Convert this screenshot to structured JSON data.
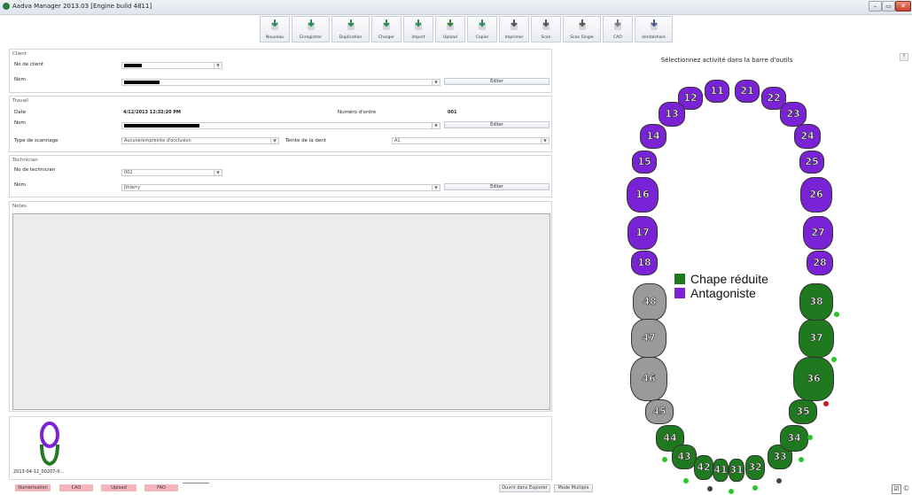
{
  "window": {
    "title": "Aadva Manager 2013.03 [Engine build 4811]",
    "controls": [
      "minimize",
      "restore",
      "close"
    ]
  },
  "toolbar": [
    {
      "label": "Nouveau",
      "icon": "new-tooth-icon"
    },
    {
      "label": "Enregistrer",
      "icon": "save-tooth-icon"
    },
    {
      "label": "Duplication",
      "icon": "duplicate-icon"
    },
    {
      "label": "Charger",
      "icon": "load-icon"
    },
    {
      "label": "Import",
      "icon": "import-icon"
    },
    {
      "label": "Upload",
      "icon": "upload-globe-icon"
    },
    {
      "label": "Copier",
      "icon": "copy-icon"
    },
    {
      "label": "Imprimer",
      "icon": "printer-icon"
    },
    {
      "label": "Scan",
      "icon": "scanner-icon"
    },
    {
      "label": "Scan Single",
      "icon": "scan-single-icon"
    },
    {
      "label": "CAO",
      "icon": "cad-icon"
    },
    {
      "label": "dentalshare",
      "icon": "dentalshare-icon"
    }
  ],
  "client": {
    "header": "Client",
    "no_label": "No de client",
    "name_label": "Nom",
    "edit": "Éditer"
  },
  "travail": {
    "header": "Travail",
    "date_label": "Date",
    "date_value": "4/12/2013  12:32:20 PM",
    "order_label": "Numéro d'ordre",
    "order_value": "001",
    "name_label": "Nom",
    "edit": "Éditer",
    "scan_type_label": "Type de scannage",
    "scan_type_value": "Aucune/empreinte d'occlusion",
    "shade_label": "Teinte de la dent",
    "shade_value": "A1"
  },
  "technician": {
    "header": "Technician",
    "no_label": "No de technicien",
    "no_value": "002",
    "name_label": "Nom",
    "name_value": "Jthierry",
    "edit": "Éditer"
  },
  "notes": {
    "header": "Notes"
  },
  "thumbnail": {
    "caption": "2013-04-12_00207-0..."
  },
  "status_chips": [
    "Numérisation",
    "CAO",
    "Upload",
    "FAO"
  ],
  "bottom_buttons": {
    "explorer": "Ouvrir dans Explorer",
    "multi": "Mode Multiple"
  },
  "chart": {
    "instruction": "Sélectionnez activité dans la barre d'outils",
    "legend": [
      {
        "label": "Chape réduite",
        "color": "#1f7a1f"
      },
      {
        "label": "Antagoniste",
        "color": "#7a22d6"
      }
    ],
    "help": "?",
    "upper_teeth": [
      "11",
      "12",
      "13",
      "14",
      "15",
      "16",
      "17",
      "18",
      "21",
      "22",
      "23",
      "24",
      "25",
      "26",
      "27",
      "28"
    ],
    "lower_grey": [
      "48",
      "47",
      "46",
      "45"
    ],
    "lower_green": [
      "44",
      "43",
      "42",
      "41",
      "31",
      "32",
      "33",
      "34",
      "35",
      "36",
      "37",
      "38"
    ],
    "colors": {
      "antagonist": "#7a22d6",
      "reduced_coping": "#1f7a1f",
      "unselected": "#9a9a9a",
      "dot_green": "#29c529",
      "dot_red": "#d01818",
      "dot_dark": "#444444"
    }
  }
}
